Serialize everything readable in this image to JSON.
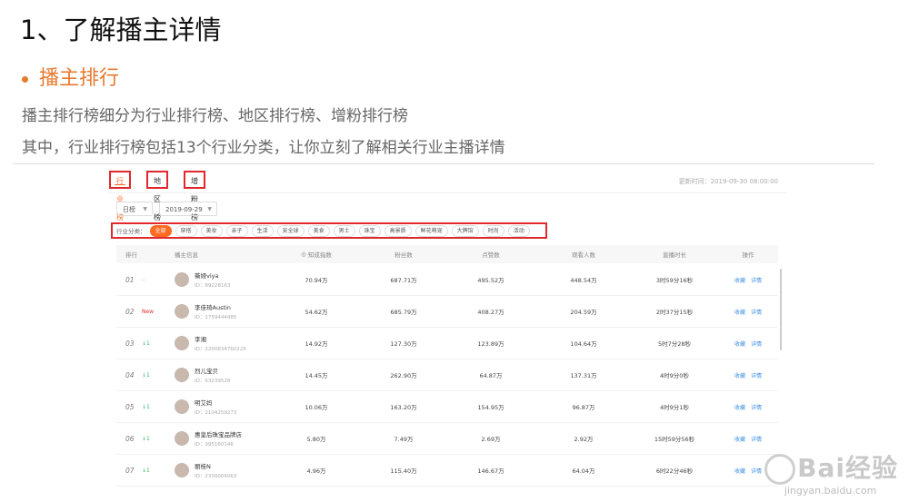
{
  "slide": {
    "title": "1、了解播主详情",
    "section": "播主排行",
    "desc1": "播主排行榜细分为行业排行榜、地区排行榜、增粉排行榜",
    "desc2": "其中，行业排行榜包括13个行业分类，让你立刻了解相关行业主播详情"
  },
  "app": {
    "tabs": [
      "行业榜",
      "地区榜",
      "增粉榜"
    ],
    "update_time": "更新时间：2019-09-30 08:00:00",
    "period_select": "日榜",
    "date_select": "2019-09-29",
    "category_label": "行业分类：",
    "categories": [
      "全部",
      "穿搭",
      "美妆",
      "亲子",
      "生活",
      "安全球",
      "美食",
      "男士",
      "珠宝",
      "高景质",
      "鲜花萌宠",
      "大牌馆",
      "时尚",
      "活动"
    ],
    "headers": [
      "排行",
      "播主信息",
      "知成指数",
      "粉丝数",
      "点赞数",
      "观看人数",
      "直播时长",
      "操作"
    ],
    "rows": [
      {
        "rank": "01",
        "change": "--",
        "change_type": "dash",
        "name": "薇娅viya",
        "id": "ID：89228163",
        "index": "70.94万",
        "fans": "687.71万",
        "likes": "495.52万",
        "views": "448.54万",
        "duration": "3时59分16秒"
      },
      {
        "rank": "02",
        "change": "New",
        "change_type": "new",
        "name": "李佳琦Austin",
        "id": "ID：1759444485",
        "index": "54.62万",
        "fans": "685.79万",
        "likes": "408.27万",
        "views": "204.59万",
        "duration": "2时37分15秒"
      },
      {
        "rank": "03",
        "change": "↓1",
        "change_type": "up",
        "name": "李湘",
        "id": "ID：2200834760225",
        "index": "14.92万",
        "fans": "127.30万",
        "likes": "123.89万",
        "views": "104.64万",
        "duration": "5时7分28秒"
      },
      {
        "rank": "04",
        "change": "↓1",
        "change_type": "up",
        "name": "烈儿宝贝",
        "id": "ID：63239528",
        "index": "14.45万",
        "fans": "262.90万",
        "likes": "64.87万",
        "views": "137.31万",
        "duration": "4时9分0秒"
      },
      {
        "rank": "05",
        "change": "↓1",
        "change_type": "up",
        "name": "明艾妈",
        "id": "ID：2104259273",
        "index": "10.06万",
        "fans": "163.20万",
        "likes": "154.95万",
        "views": "96.87万",
        "duration": "4时9分1秒"
      },
      {
        "rank": "06",
        "change": "↓1",
        "change_type": "up",
        "name": "惠皇后珠宝品牌店",
        "id": "ID：395160146",
        "index": "5.80万",
        "fans": "7.49万",
        "likes": "2.69万",
        "views": "2.92万",
        "duration": "15时59分56秒"
      },
      {
        "rank": "07",
        "change": "↓1",
        "change_type": "up",
        "name": "丽桂N",
        "id": "ID：2330004063",
        "index": "4.96万",
        "fans": "115.40万",
        "likes": "146.67万",
        "views": "64.04万",
        "duration": "6时22分46秒"
      }
    ],
    "op_follow": "收藏",
    "op_detail": "详情"
  },
  "watermark": {
    "brand": "Bai经验",
    "url": "jingyan.baidu.com"
  },
  "colors": {
    "accent": "#ff6a22",
    "section": "#e87a30",
    "highlight_box": "#e0282e",
    "link": "#3a8ee6",
    "up": "#35b36b"
  }
}
